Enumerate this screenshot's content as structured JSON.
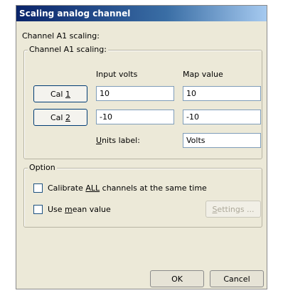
{
  "window": {
    "title": "Scaling analog channel"
  },
  "heading": "Channel A1 scaling:",
  "scaling_group": {
    "legend": "Channel A1 scaling:",
    "col_input": "Input volts",
    "col_map": "Map value",
    "cal1": {
      "pre": "Cal ",
      "key": "1",
      "input": "10",
      "map": "10"
    },
    "cal2": {
      "pre": "Cal ",
      "key": "2",
      "input": "-10",
      "map": "-10"
    },
    "units": {
      "key": "U",
      "rest": "nits label:",
      "value": "Volts"
    }
  },
  "option_group": {
    "legend": "Option",
    "calibrate_all": {
      "pre": "Calibrate ",
      "key": "ALL",
      "post": " channels at the same time",
      "checked": false
    },
    "use_mean": {
      "pre": "Use ",
      "key": "m",
      "post": "ean value",
      "checked": false
    },
    "settings": {
      "key": "S",
      "rest": "ettings ...",
      "disabled": true
    }
  },
  "footer": {
    "ok": "OK",
    "cancel": "Cancel"
  }
}
